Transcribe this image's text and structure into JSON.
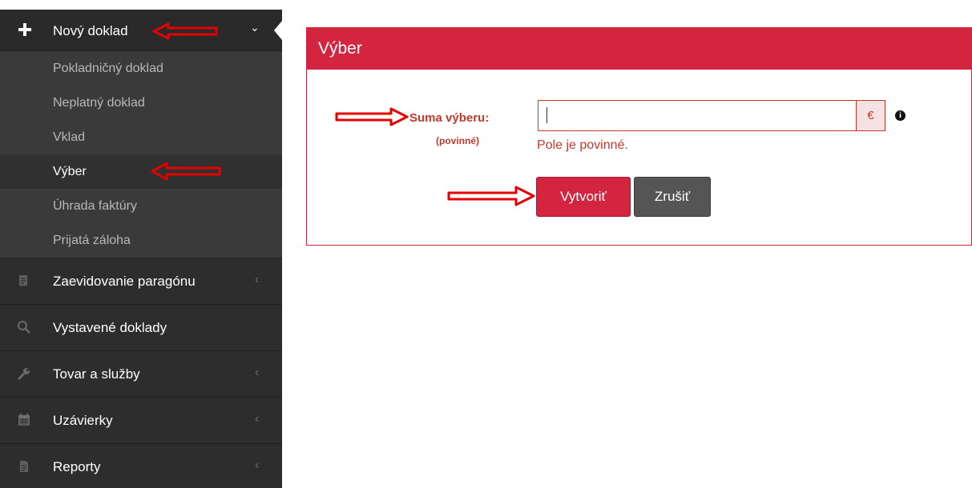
{
  "sidebar": {
    "header": {
      "label": "Nový doklad"
    },
    "submenu": [
      {
        "label": "Pokladničný doklad",
        "active": false
      },
      {
        "label": "Neplatný doklad",
        "active": false
      },
      {
        "label": "Vklad",
        "active": false
      },
      {
        "label": "Výber",
        "active": true
      },
      {
        "label": "Úhrada faktúry",
        "active": false
      },
      {
        "label": "Prijatá záloha",
        "active": false
      }
    ],
    "items": [
      {
        "label": "Zaevidovanie paragónu",
        "icon": "receipt-icon",
        "has_submenu": true
      },
      {
        "label": "Vystavené doklady",
        "icon": "search-icon",
        "has_submenu": false
      },
      {
        "label": "Tovar a služby",
        "icon": "wrench-icon",
        "has_submenu": true
      },
      {
        "label": "Uzávierky",
        "icon": "calendar-icon",
        "has_submenu": true
      },
      {
        "label": "Reporty",
        "icon": "document-icon",
        "has_submenu": true
      }
    ]
  },
  "panel": {
    "title": "Výber",
    "field_label": "Suma výberu:",
    "field_required": "(povinné)",
    "input_value": "",
    "currency": "€",
    "error": "Pole je povinné.",
    "create_button": "Vytvoriť",
    "cancel_button": "Zrušiť"
  },
  "colors": {
    "accent": "#d3253f",
    "sidebar_bg": "#2d2d2d",
    "annotation_arrow": "#e60000"
  }
}
